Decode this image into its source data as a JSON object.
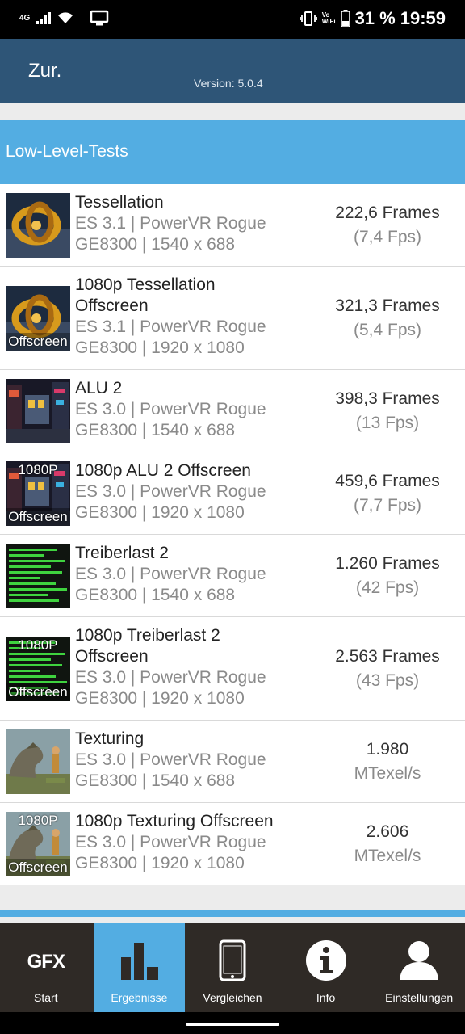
{
  "status_bar": {
    "network": "4G",
    "battery_percent": "31 %",
    "time": "19:59",
    "vowifi_line1": "Vo",
    "vowifi_line2": "WiFi"
  },
  "app_bar": {
    "back_label": "Zur.",
    "version": "Version: 5.0.4"
  },
  "section": {
    "title": "Low-Level-Tests"
  },
  "results": [
    {
      "title_lines": [
        "Tessellation"
      ],
      "sub_lines": [
        "ES 3.1 | PowerVR Rogue",
        "GE8300 | 1540 x 688"
      ],
      "value": "222,6 Frames",
      "secondary": "(7,4 Fps)",
      "thumb": "tessellation",
      "badges": []
    },
    {
      "title_lines": [
        "1080p Tessellation",
        "Offscreen"
      ],
      "sub_lines": [
        "ES 3.1 | PowerVR Rogue",
        "GE8300 | 1920 x 1080"
      ],
      "value": "321,3 Frames",
      "secondary": "(5,4 Fps)",
      "thumb": "tessellation",
      "badges": [
        "Offscreen"
      ]
    },
    {
      "title_lines": [
        "ALU 2"
      ],
      "sub_lines": [
        "ES 3.0 | PowerVR Rogue",
        "GE8300 | 1540 x 688"
      ],
      "value": "398,3 Frames",
      "secondary": "(13 Fps)",
      "thumb": "alu",
      "badges": []
    },
    {
      "title_lines": [
        "1080p ALU 2 Offscreen"
      ],
      "sub_lines": [
        "ES 3.0 | PowerVR Rogue",
        "GE8300 | 1920 x 1080"
      ],
      "value": "459,6 Frames",
      "secondary": "(7,7 Fps)",
      "thumb": "alu",
      "badges": [
        "1080P",
        "Offscreen"
      ]
    },
    {
      "title_lines": [
        "Treiberlast 2"
      ],
      "sub_lines": [
        "ES 3.0 | PowerVR Rogue",
        "GE8300 | 1540 x 688"
      ],
      "value": "1.260 Frames",
      "secondary": "(42 Fps)",
      "thumb": "driver",
      "badges": []
    },
    {
      "title_lines": [
        "1080p Treiberlast 2",
        "Offscreen"
      ],
      "sub_lines": [
        "ES 3.0 | PowerVR Rogue",
        "GE8300 | 1920 x 1080"
      ],
      "value": "2.563 Frames",
      "secondary": "(43 Fps)",
      "thumb": "driver",
      "badges": [
        "1080P",
        "Offscreen"
      ]
    },
    {
      "title_lines": [
        "Texturing"
      ],
      "sub_lines": [
        "ES 3.0 | PowerVR Rogue",
        "GE8300 | 1540 x 688"
      ],
      "value": "1.980",
      "secondary": "MTexel/s",
      "thumb": "texturing",
      "badges": []
    },
    {
      "title_lines": [
        "1080p Texturing Offscreen"
      ],
      "sub_lines": [
        "ES 3.0 | PowerVR Rogue",
        "GE8300 | 1920 x 1080"
      ],
      "value": "2.606",
      "secondary": "MTexel/s",
      "thumb": "texturing",
      "badges": [
        "1080P",
        "Offscreen"
      ]
    }
  ],
  "tabs": [
    {
      "label": "Start",
      "icon": "gfx-logo-icon",
      "icon_text": "GFX",
      "active": false
    },
    {
      "label": "Ergebnisse",
      "icon": "bar-chart-icon",
      "active": true
    },
    {
      "label": "Vergleichen",
      "icon": "phone-icon",
      "active": false
    },
    {
      "label": "Info",
      "icon": "info-icon",
      "active": false
    },
    {
      "label": "Einstellungen",
      "icon": "person-icon",
      "active": false
    }
  ],
  "colors": {
    "app_bar": "#2e5577",
    "accent": "#53ade2",
    "tab_bar": "#2f2a26"
  }
}
